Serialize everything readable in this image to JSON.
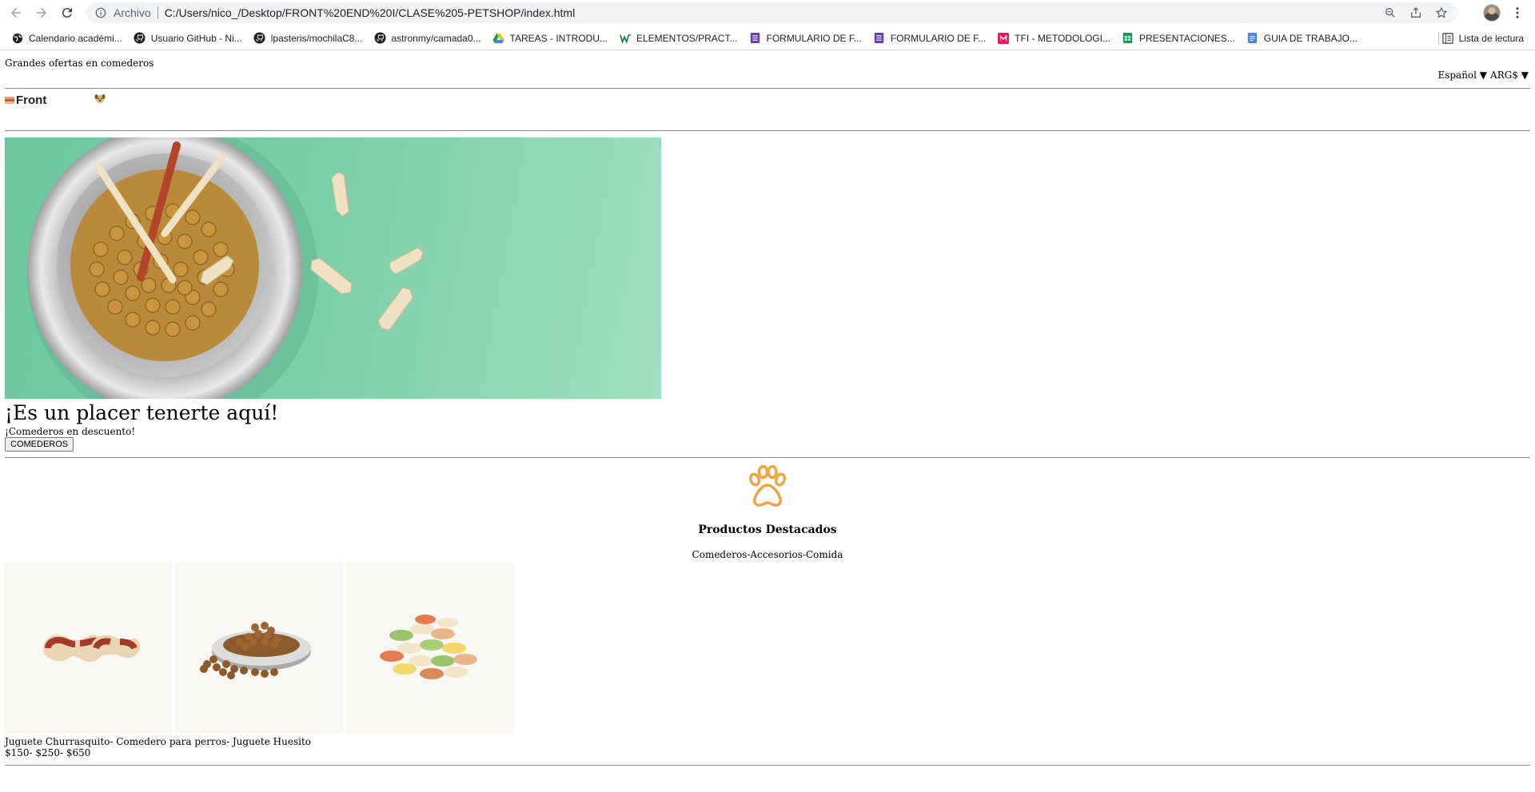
{
  "browser": {
    "scheme_label": "Archivo",
    "url": "C:/Users/nico_/Desktop/FRONT%20END%20I/CLASE%205-PETSHOP/index.html",
    "bookmarks": [
      {
        "label": "Calendario académi...",
        "icon": "globe-icon"
      },
      {
        "label": "Usuario GitHub - Ni...",
        "icon": "github-icon"
      },
      {
        "label": "lpasteris/mochilaC8...",
        "icon": "github-icon"
      },
      {
        "label": "astronmy/camada0...",
        "icon": "github-icon"
      },
      {
        "label": "TAREAS - INTRODU...",
        "icon": "drive-icon"
      },
      {
        "label": "ELEMENTOS/PRACT...",
        "icon": "w-icon"
      },
      {
        "label": "FORMULARIO DE F...",
        "icon": "forms-icon"
      },
      {
        "label": "FORMULARIO DE F...",
        "icon": "forms-icon"
      },
      {
        "label": "TFI - METODOLOGI...",
        "icon": "m-icon"
      },
      {
        "label": "PRESENTACIONES...",
        "icon": "sheets-icon"
      },
      {
        "label": "GUIA DE TRABAJO...",
        "icon": "docs-icon"
      }
    ],
    "reading_list": "Lista de lectura"
  },
  "page": {
    "promo_text": "Grandes ofertas en comederos",
    "language": "Español ▼",
    "currency": "ARG$ ▼",
    "logo_text": "Front",
    "hero": {
      "title": "¡Es un placer tenerte aquí!",
      "subtitle": "¡Comederos en descuento!",
      "button": "COMEDEROS"
    },
    "featured": {
      "title": "Productos Destacados",
      "categories": "Comederos-Accesorios-Comida",
      "product_names": "Juguete Churrasquito- Comedero para perros- Juguete Huesito",
      "product_prices": "$150- $250- $650"
    }
  },
  "colors": {
    "hero_green": "#79cfa7",
    "paw_orange": "#f0a442"
  }
}
